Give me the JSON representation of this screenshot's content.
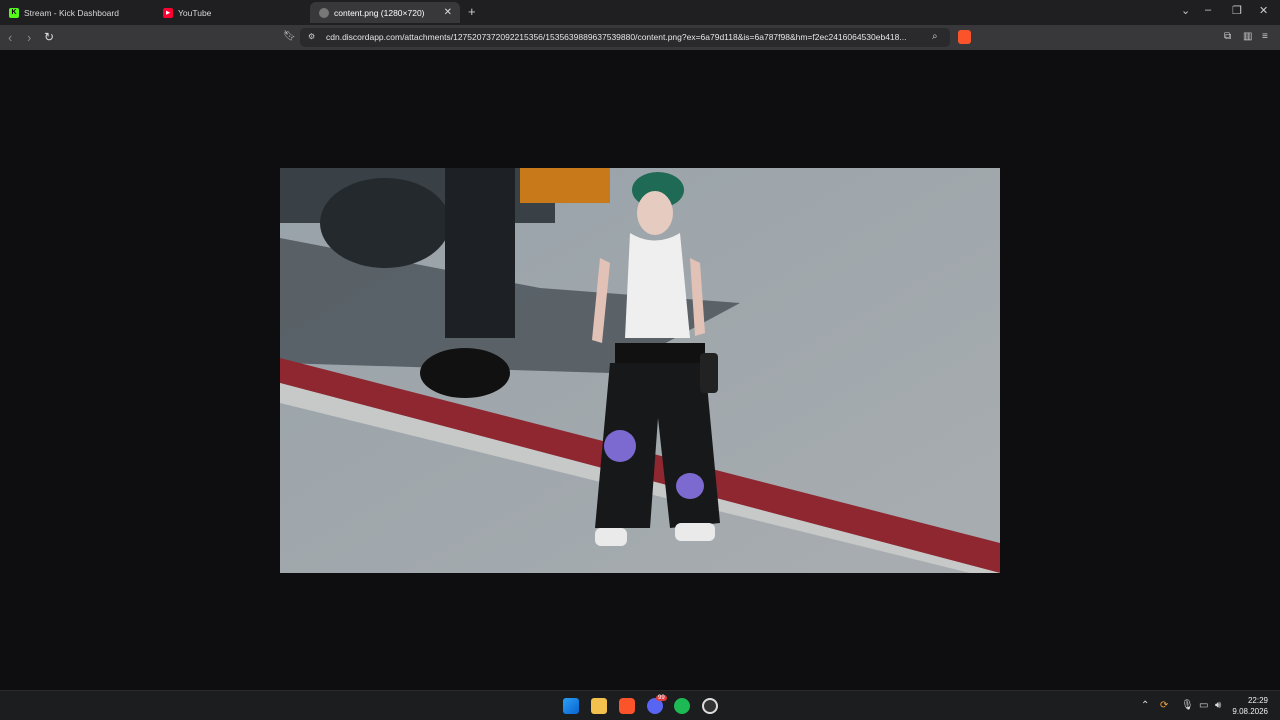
{
  "tabs": [
    {
      "title": "Stream - Kick Dashboard"
    },
    {
      "title": "YouTube"
    },
    {
      "title": "content.png (1280×720)"
    }
  ],
  "address": {
    "url": "cdn.discordapp.com/attachments/1275207372092215356/1535639889637539880/content.png?ex=6a79d118&is=6a787f98&hm=f2ec2416064530eb418..."
  },
  "image": {
    "alt": "content.png"
  },
  "taskbar": {
    "badge_discord": "99",
    "time": "22:29",
    "date": "9.08.2026"
  },
  "colors": {
    "kick": "#53fc18",
    "youtube": "#ff0033",
    "brave": "#fb542b",
    "discord": "#5865f2",
    "spotify": "#1db954"
  }
}
